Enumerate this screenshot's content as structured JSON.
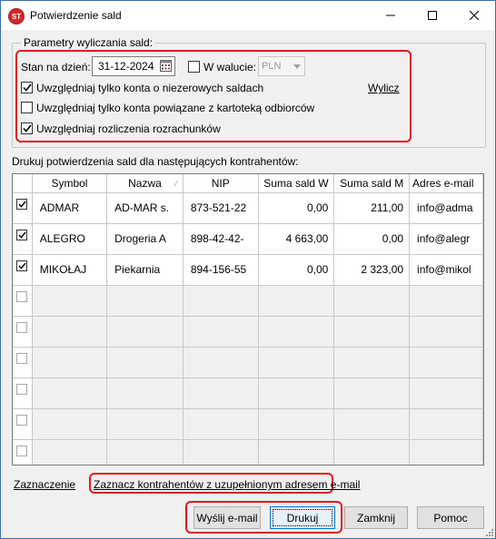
{
  "window": {
    "title": "Potwierdzenie sald",
    "icon_text": "ST"
  },
  "params": {
    "group_title": "Parametry wyliczania sald:",
    "date_label": "Stan na dzień:",
    "date_value": "31-12-2024",
    "currency_label": "W walucie:",
    "currency_checked": false,
    "currency_value": "PLN",
    "opt1_label": "Uwzględniaj tylko konta o niezerowych saldach",
    "opt1_checked": true,
    "opt2_label": "Uwzględniaj tylko konta powiązane z kartoteką odbiorców",
    "opt2_checked": false,
    "opt3_label": "Uwzględniaj rozliczenia rozrachunków",
    "opt3_checked": true,
    "calculate_link": "Wylicz"
  },
  "grid": {
    "caption": "Drukuj potwierdzenia sald dla następujących kontrahentów:",
    "columns": [
      "Symbol",
      "Nazwa",
      "NIP",
      "Suma sald W",
      "Suma sald M",
      "Adres e-mail"
    ],
    "rows": [
      {
        "checked": true,
        "symbol": "ADMAR",
        "nazwa": "AD-MAR s.",
        "nip": "873-521-22",
        "suma_w": "0,00",
        "suma_m": "211,00",
        "email": "info@adma"
      },
      {
        "checked": true,
        "symbol": "ALEGRO",
        "nazwa": "Drogeria A",
        "nip": "898-42-42-",
        "suma_w": "4 663,00",
        "suma_m": "0,00",
        "email": "info@alegr"
      },
      {
        "checked": true,
        "symbol": "MIKOŁAJ",
        "nazwa": "Piekarnia",
        "nip": "894-156-55",
        "suma_w": "0,00",
        "suma_m": "2 323,00",
        "email": "info@mikol"
      }
    ],
    "empty_rows": 6
  },
  "footer": {
    "selection_link": "Zaznaczenie",
    "mark_email_link": "Zaznacz kontrahentów z uzupełnionym adresem e-mail",
    "send_email_button": "Wyślij e-mail",
    "print_button": "Drukuj",
    "close_button": "Zamknij",
    "help_button": "Pomoc"
  },
  "colors": {
    "highlight": "#e0191f",
    "window_bg": "#f0f0f0",
    "grid_lines": "#c8c8c8"
  }
}
